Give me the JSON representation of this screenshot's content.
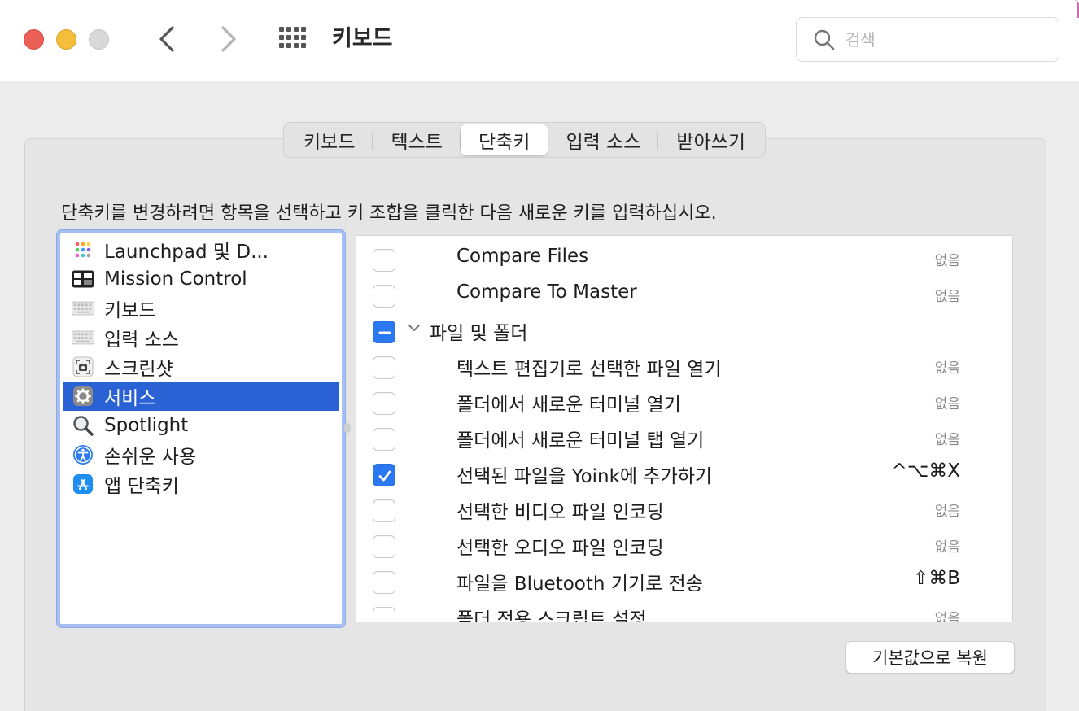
{
  "window": {
    "title": "키보드",
    "search_placeholder": "검색"
  },
  "tabs": [
    {
      "label": "키보드",
      "active": false
    },
    {
      "label": "텍스트",
      "active": false
    },
    {
      "label": "단축키",
      "active": true
    },
    {
      "label": "입력 소스",
      "active": false
    },
    {
      "label": "받아쓰기",
      "active": false
    }
  ],
  "instruction": "단축키를 변경하려면 항목을 선택하고 키 조합을 클릭한 다음 새로운 키를 입력하십시오.",
  "categories": [
    {
      "label": "Launchpad 및 D...",
      "icon": "launchpad-icon"
    },
    {
      "label": "Mission Control",
      "icon": "mission-control-icon"
    },
    {
      "label": "키보드",
      "icon": "keyboard-icon"
    },
    {
      "label": "입력 소스",
      "icon": "keyboard-icon"
    },
    {
      "label": "스크린샷",
      "icon": "screenshot-icon"
    },
    {
      "label": "서비스",
      "icon": "gear-icon",
      "selected": true
    },
    {
      "label": "Spotlight",
      "icon": "magnifier-icon"
    },
    {
      "label": "손쉬운 사용",
      "icon": "accessibility-icon"
    },
    {
      "label": "앱 단축키",
      "icon": "app-store-icon"
    }
  ],
  "shortcuts": [
    {
      "label": "Compare Files",
      "state": "unchecked",
      "shortcut": "없음"
    },
    {
      "label": "Compare To Master",
      "state": "unchecked",
      "shortcut": "없음"
    },
    {
      "label": "파일 및 폴더",
      "state": "mixed",
      "group": true,
      "shortcut": ""
    },
    {
      "label": "텍스트 편집기로 선택한 파일 열기",
      "state": "unchecked",
      "shortcut": "없음"
    },
    {
      "label": "폴더에서 새로운 터미널 열기",
      "state": "unchecked",
      "shortcut": "없음"
    },
    {
      "label": "폴더에서 새로운 터미널 탭 열기",
      "state": "unchecked",
      "shortcut": "없음"
    },
    {
      "label": "선택된 파일을 Yoink에 추가하기",
      "state": "checked",
      "shortcut": "^⌥⌘X"
    },
    {
      "label": "선택한 비디오 파일 인코딩",
      "state": "unchecked",
      "shortcut": "없음"
    },
    {
      "label": "선택한 오디오 파일 인코딩",
      "state": "unchecked",
      "shortcut": "없음"
    },
    {
      "label": "파일을 Bluetooth 기기로 전송",
      "state": "unchecked",
      "shortcut": "⇧⌘B"
    },
    {
      "label": "폴더 적용 스크립트 설정...",
      "state": "unchecked",
      "shortcut": "없음"
    }
  ],
  "restore_button": "기본값으로 복원",
  "colors": {
    "accent": "#2a62d6",
    "checkbox_blue": "#2a78f1",
    "close": "#ec5f57",
    "minimize": "#f4bd3a",
    "zoom_inactive": "#d9d9d9"
  }
}
